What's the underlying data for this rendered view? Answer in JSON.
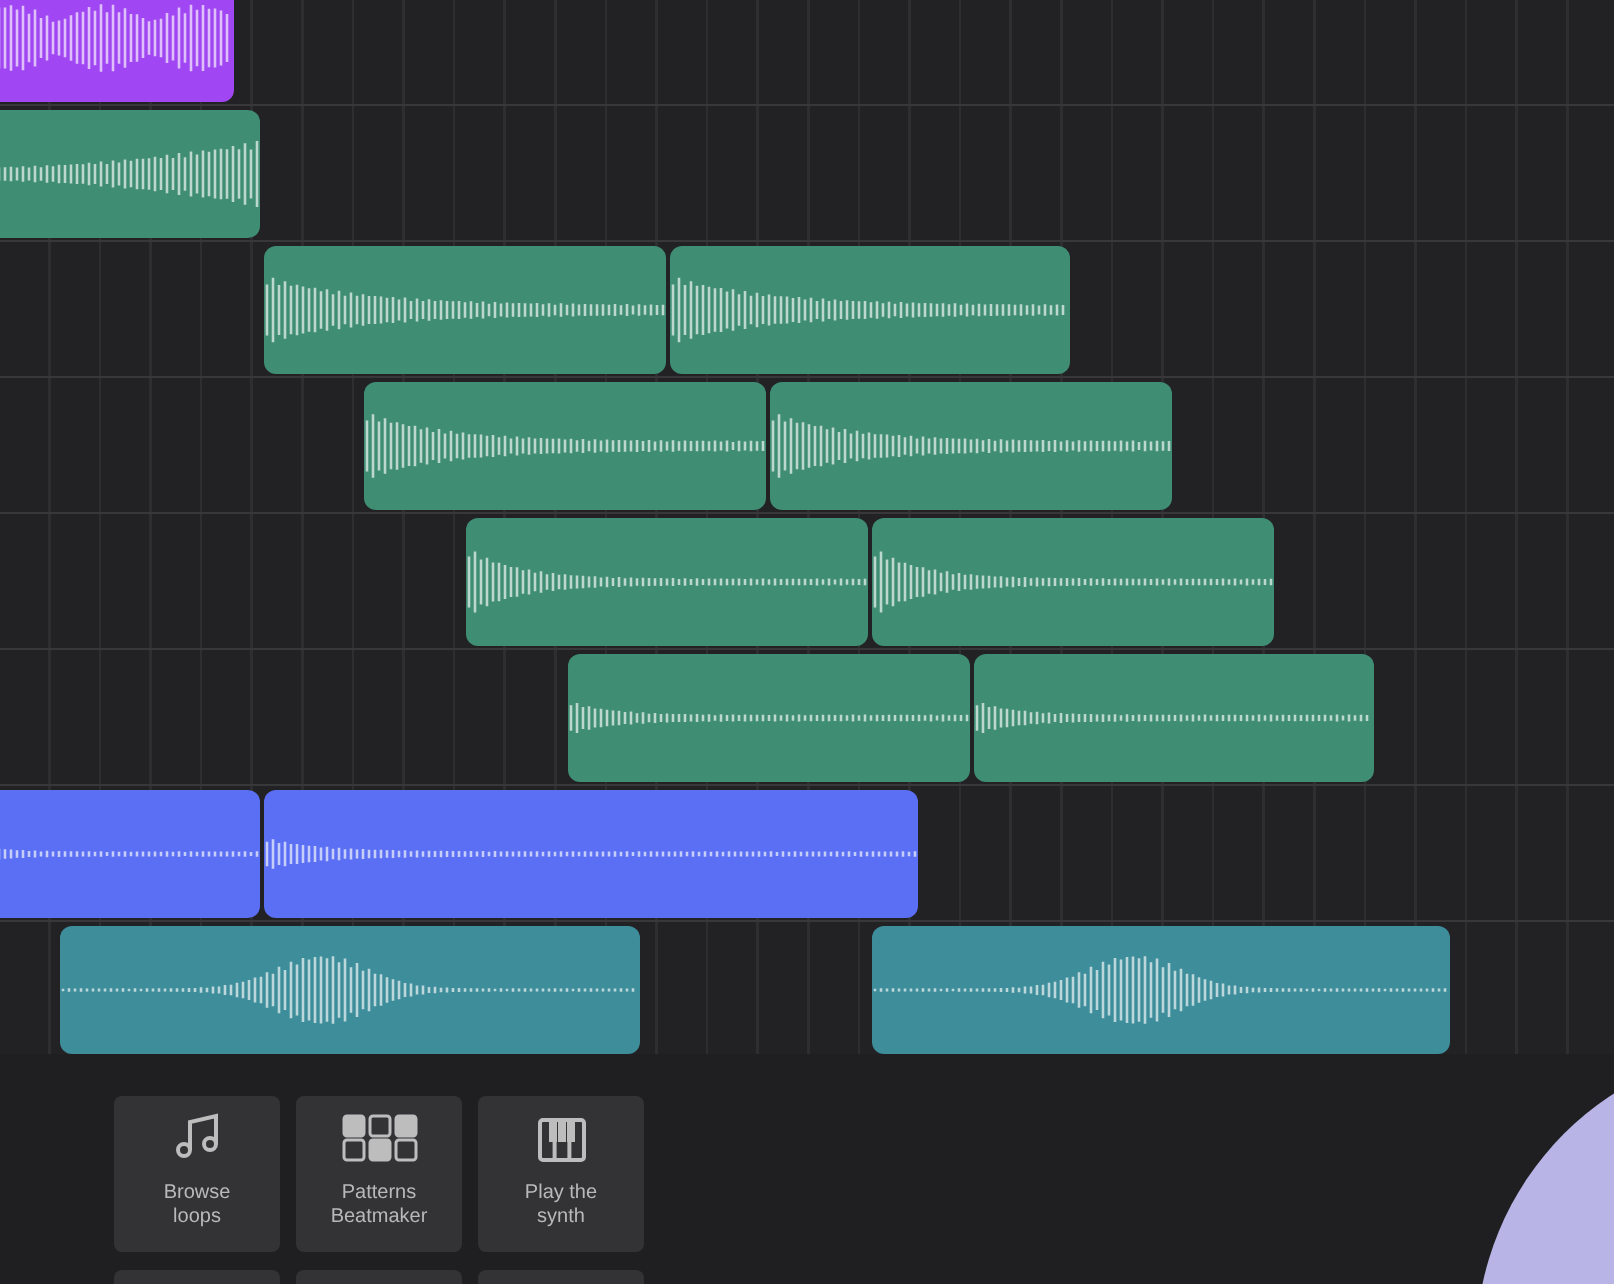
{
  "tracks": [
    {
      "clips": [
        {
          "color": "#a046f2"
        }
      ]
    },
    {
      "clips": [
        {
          "color": "#3f8d72"
        }
      ]
    },
    {
      "clips": [
        {
          "color": "#3f8d72"
        },
        {
          "color": "#3f8d72"
        }
      ]
    },
    {
      "clips": [
        {
          "color": "#3f8d72"
        },
        {
          "color": "#3f8d72"
        }
      ]
    },
    {
      "clips": [
        {
          "color": "#3f8d72"
        },
        {
          "color": "#3f8d72"
        }
      ]
    },
    {
      "clips": [
        {
          "color": "#3f8d72"
        },
        {
          "color": "#3f8d72"
        }
      ]
    },
    {
      "clips": [
        {
          "color": "#5a6ff4"
        },
        {
          "color": "#5a6ff4"
        }
      ]
    },
    {
      "clips": [
        {
          "color": "#3e8d9b"
        },
        {
          "color": "#3e8d9b"
        }
      ]
    }
  ],
  "tool_buttons": [
    {
      "kind": "loops",
      "label": "Browse\nloops"
    },
    {
      "kind": "patterns",
      "label": "Patterns\nBeatmaker"
    },
    {
      "kind": "synth",
      "label": "Play the\nsynth"
    }
  ]
}
